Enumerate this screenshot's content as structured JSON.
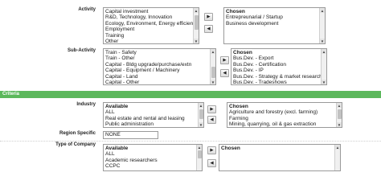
{
  "activity": {
    "label": "Activity",
    "available_items": [
      "Capital investment",
      "R&D, Technology, Innovation",
      "Ecology, Environment, Energy efficiency",
      "Employment",
      "Training",
      "Other"
    ],
    "chosen_header": "Chosen",
    "chosen_items": [
      "Entrepreunarial / Startup",
      "Business development"
    ]
  },
  "sub_activity": {
    "label": "Sub-Activity",
    "available_items": [
      "Train - Safety",
      "Train - Other",
      "Capital - Bldg upgrade/purchase/extn",
      "Capital - Equipment / Machinery",
      "Capital - Land",
      "Capital - Other"
    ],
    "chosen_header": "Chosen",
    "chosen_items": [
      "Bus.Dev. - Export",
      "Bus.Dev. - Certification",
      "Bus.Dev. - IP",
      "Bus.Dev. - Strategy & market research",
      "Bus.Dev. - Tradeshows"
    ]
  },
  "section": {
    "title": "Criteria",
    "color": "#5cb85c"
  },
  "industry": {
    "label": "Industry",
    "available_header": "Available",
    "available_items": [
      "ALL",
      "Real estate and rental and leasing",
      "Public administration"
    ],
    "chosen_header": "Chosen",
    "chosen_items": [
      "Agriculture and forestry (excl. farming)",
      "Farming",
      "Mining, quarrying, oil & gas extraction"
    ]
  },
  "region": {
    "label": "Region Specific",
    "value": "NONE"
  },
  "company_type": {
    "label": "Type of Company",
    "available_header": "Available",
    "available_items": [
      "ALL",
      "Academic researchers",
      "CCPC"
    ],
    "chosen_header": "Chosen",
    "chosen_items": []
  },
  "buttons": {
    "add_icon": "triangle-right",
    "remove_icon": "triangle-left",
    "add_glyph": "▶",
    "remove_glyph": "◀"
  }
}
